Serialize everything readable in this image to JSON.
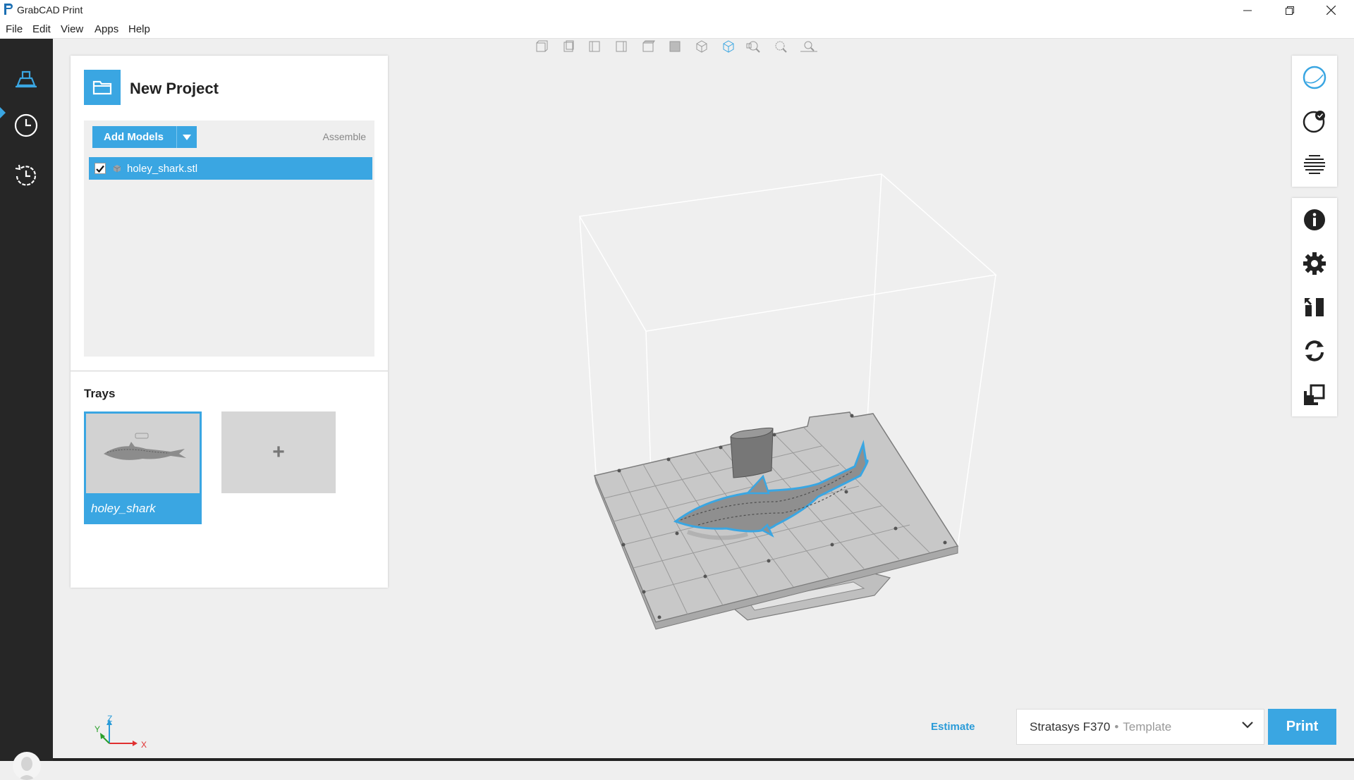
{
  "window": {
    "title": "GrabCAD Print",
    "controls": [
      "minimize-icon",
      "restore-icon",
      "close-icon"
    ]
  },
  "menu": [
    "File",
    "Edit",
    "View",
    "Apps",
    "Help"
  ],
  "leftnav": {
    "items": [
      {
        "name": "prepare",
        "icon": "tray-prepare-icon",
        "active": true
      },
      {
        "name": "queue",
        "icon": "clock-icon",
        "active": false
      },
      {
        "name": "history",
        "icon": "history-icon",
        "active": false
      }
    ]
  },
  "project": {
    "title": "New Project",
    "add_models_label": "Add Models",
    "assemble_label": "Assemble",
    "models": [
      {
        "name": "holey_shark.stl",
        "checked": true
      }
    ],
    "trays_label": "Trays",
    "trays": [
      {
        "name": "holey_shark",
        "selected": true
      }
    ],
    "add_tray_label": "+"
  },
  "view_toolbar": [
    "view-front-icon",
    "view-back-icon",
    "view-left-icon",
    "view-right-icon",
    "view-top-icon",
    "view-bottom-icon",
    "view-iso-icon",
    "view-iso-active-icon",
    "zoom-fit-icon",
    "zoom-selection-icon",
    "zoom-tray-icon"
  ],
  "right_tools": {
    "group1": [
      "model-view-icon",
      "model-view-check-icon",
      "slice-view-icon"
    ],
    "group2": [
      "info-icon",
      "settings-icon",
      "arrange-icon",
      "rotate-icon",
      "scale-icon"
    ]
  },
  "axes": {
    "x": "X",
    "y": "Y",
    "z": "Z"
  },
  "footer": {
    "estimate_label": "Estimate",
    "printer_name": "Stratasys F370",
    "printer_separator": "•",
    "printer_template": "Template",
    "print_label": "Print"
  },
  "colors": {
    "accent": "#3aa6e2",
    "sidebar": "#262626",
    "viewport": "#efefef"
  }
}
